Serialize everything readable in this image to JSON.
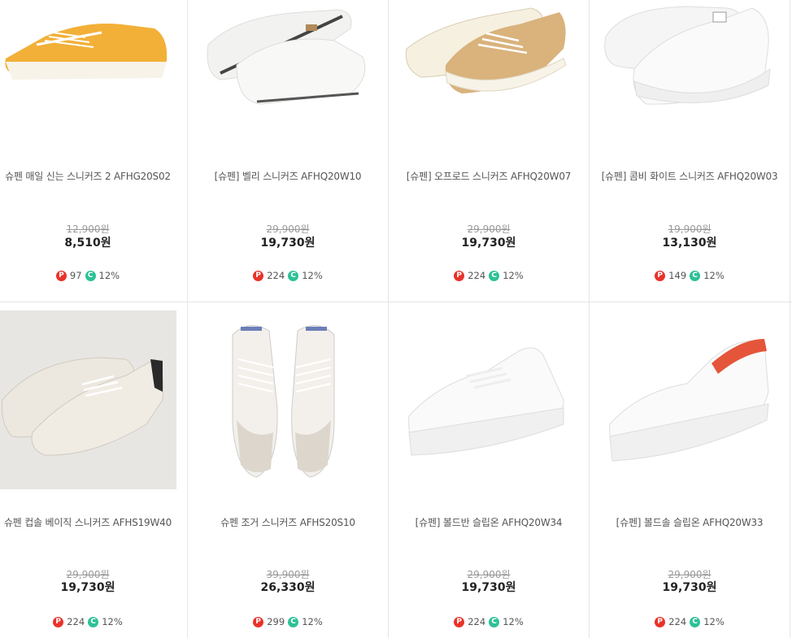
{
  "products": [
    {
      "title": "슈펜 매일 신는 스니커즈 2 AFHG20S02",
      "original_price": "12,900원",
      "price": "8,510원",
      "points": "97",
      "coupon": "12%",
      "shoe_color": "#f4b63c",
      "image": "yellow-canvas-sneaker"
    },
    {
      "title": "[슈펜] 벨리 스니커즈 AFHQ20W10",
      "original_price": "29,900원",
      "price": "19,730원",
      "points": "224",
      "coupon": "12%",
      "shoe_color": "#f4f4f2",
      "image": "white-sneaker-pair"
    },
    {
      "title": "[슈펜] 오프로드 스니커즈 AFHQ20W07",
      "original_price": "29,900원",
      "price": "19,730원",
      "points": "224",
      "coupon": "12%",
      "shoe_color": "#d8b07a",
      "image": "beige-canvas-sneaker-pair"
    },
    {
      "title": "[슈펜] 콤비 화이트 스니커즈 AFHQ20W03",
      "original_price": "19,900원",
      "price": "13,130원",
      "points": "149",
      "coupon": "12%",
      "shoe_color": "#f7f7f7",
      "image": "white-platform-sneaker-pair"
    },
    {
      "title": "슈펜 컵솔 베이직 스니커즈 AFHS19W40",
      "original_price": "29,900원",
      "price": "19,730원",
      "points": "224",
      "coupon": "12%",
      "shoe_color": "#e9e5dc",
      "image": "ivory-leather-sneaker-pair"
    },
    {
      "title": "슈펜 조거 스니커즈 AFHS20S10",
      "original_price": "39,900원",
      "price": "26,330원",
      "points": "299",
      "coupon": "12%",
      "shoe_color": "#f3f0ec",
      "image": "jogger-sneaker-pair"
    },
    {
      "title": "[슈펜] 볼드반 슬립온 AFHQ20W34",
      "original_price": "29,900원",
      "price": "19,730원",
      "points": "224",
      "coupon": "12%",
      "shoe_color": "#f8f8f8",
      "image": "white-chunky-sneaker"
    },
    {
      "title": "[슈펜] 볼드솔 슬립온 AFHQ20W33",
      "original_price": "29,900원",
      "price": "19,730원",
      "points": "224",
      "coupon": "12%",
      "shoe_color": "#f8f8f8",
      "image": "white-slip-on"
    }
  ],
  "badges": {
    "points_letter": "P",
    "coupon_letter": "C"
  }
}
